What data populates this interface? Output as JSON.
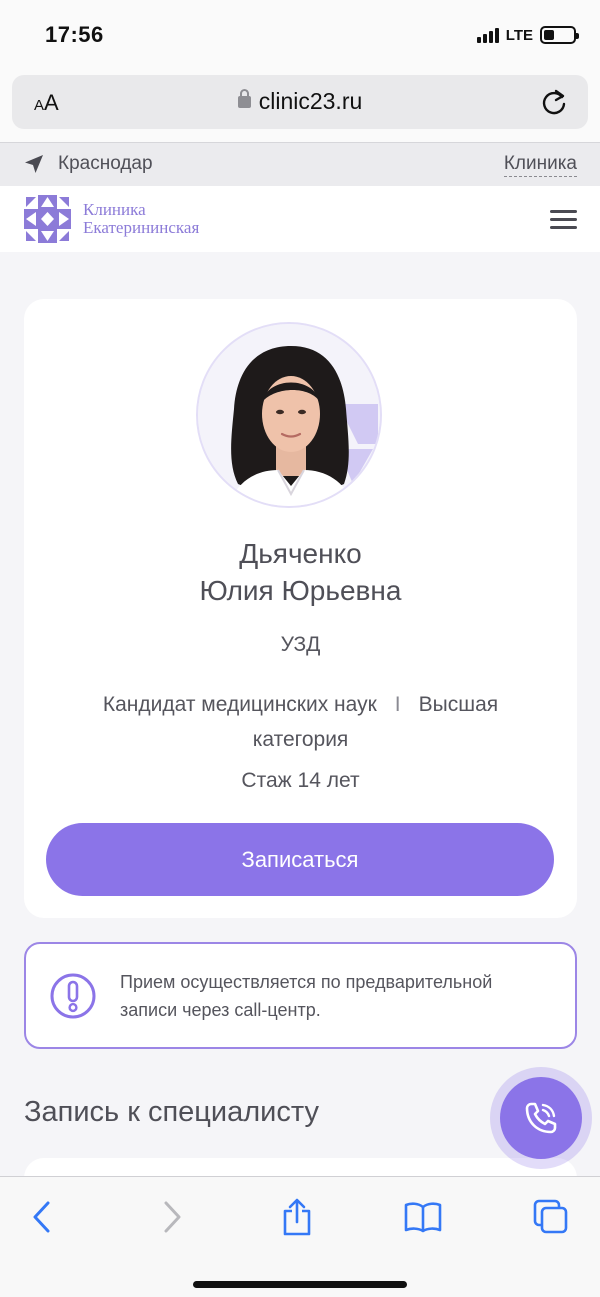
{
  "status_bar": {
    "time": "17:56",
    "network": "LTE",
    "battery_level": 0.35
  },
  "browser": {
    "text_size_label": "AA",
    "url": "clinic23.ru"
  },
  "location": {
    "city": "Краснодар",
    "clinic_link": "Клиника"
  },
  "brand": {
    "name_line1": "Клиника",
    "name_line2": "Екатерининская",
    "color": "#8c7bd8"
  },
  "doctor": {
    "name_line1": "Дьяченко",
    "name_line2": "Юлия Юрьевна",
    "specialty": "УЗД",
    "degree": "Кандидат медицинских наук",
    "separator": "I",
    "category": "Высшая категория",
    "experience": "Стаж 14 лет"
  },
  "actions": {
    "book_label": "Записаться"
  },
  "notice": {
    "text": "Прием осуществляется по предварительной записи через call-центр."
  },
  "sections": {
    "booking_title": "Запись к специалисту"
  },
  "colors": {
    "accent": "#8b74e8",
    "ios_blue": "#3478f6",
    "background": "#f5f5f8"
  },
  "toolbar": {
    "icons": [
      "back-icon",
      "forward-icon",
      "share-icon",
      "bookmarks-icon",
      "tabs-icon"
    ]
  }
}
